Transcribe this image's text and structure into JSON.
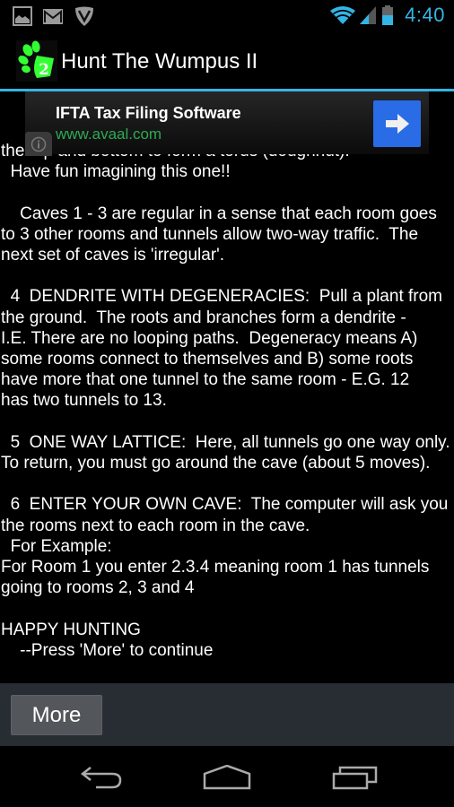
{
  "status_bar": {
    "notification_icons": [
      "gallery-icon",
      "gmail-icon",
      "vpn-shield-icon"
    ],
    "system_icons": [
      "wifi-icon",
      "cell-signal-icon",
      "battery-icon"
    ],
    "time": "4:40",
    "accent_color": "#33b5e5"
  },
  "action_bar": {
    "app_icon_badge": "2",
    "title": "Hunt The Wumpus II"
  },
  "ad": {
    "title": "IFTA Tax Filing Software",
    "url": "www.avaal.com",
    "url_color": "#2eaa55",
    "button_color": "#2a6ce6"
  },
  "content": {
    "lines": [
      "the top and bottom to form a torus (doughnut).",
      "  Have fun imagining this one!!",
      "",
      "    Caves 1 - 3 are regular in a sense that each room goes",
      "to 3 other rooms and tunnels allow two-way traffic.  The",
      "next set of caves is 'irregular'.",
      "",
      "  4  DENDRITE WITH DEGENERACIES:  Pull a plant from",
      "the ground.  The roots and branches form a dendrite -",
      "I.E. There are no looping paths.  Degeneracy means A)",
      "some rooms connect to themselves and B) some roots",
      "have more that one tunnel to the same room - E.G. 12",
      "has two tunnels to 13.",
      "",
      "  5  ONE WAY LATTICE:  Here, all tunnels go one way only.",
      "To return, you must go around the cave (about 5 moves).",
      "",
      "  6  ENTER YOUR OWN CAVE:  The computer will ask you",
      "the rooms next to each room in the cave.",
      "  For Example:",
      "For Room 1 you enter 2.3.4 meaning room 1 has tunnels",
      "going to rooms 2, 3 and 4",
      "",
      "HAPPY HUNTING",
      "    --Press 'More' to continue"
    ]
  },
  "button_bar": {
    "more_label": "More"
  },
  "nav_bar": {
    "buttons": [
      "back",
      "home",
      "recents"
    ]
  }
}
